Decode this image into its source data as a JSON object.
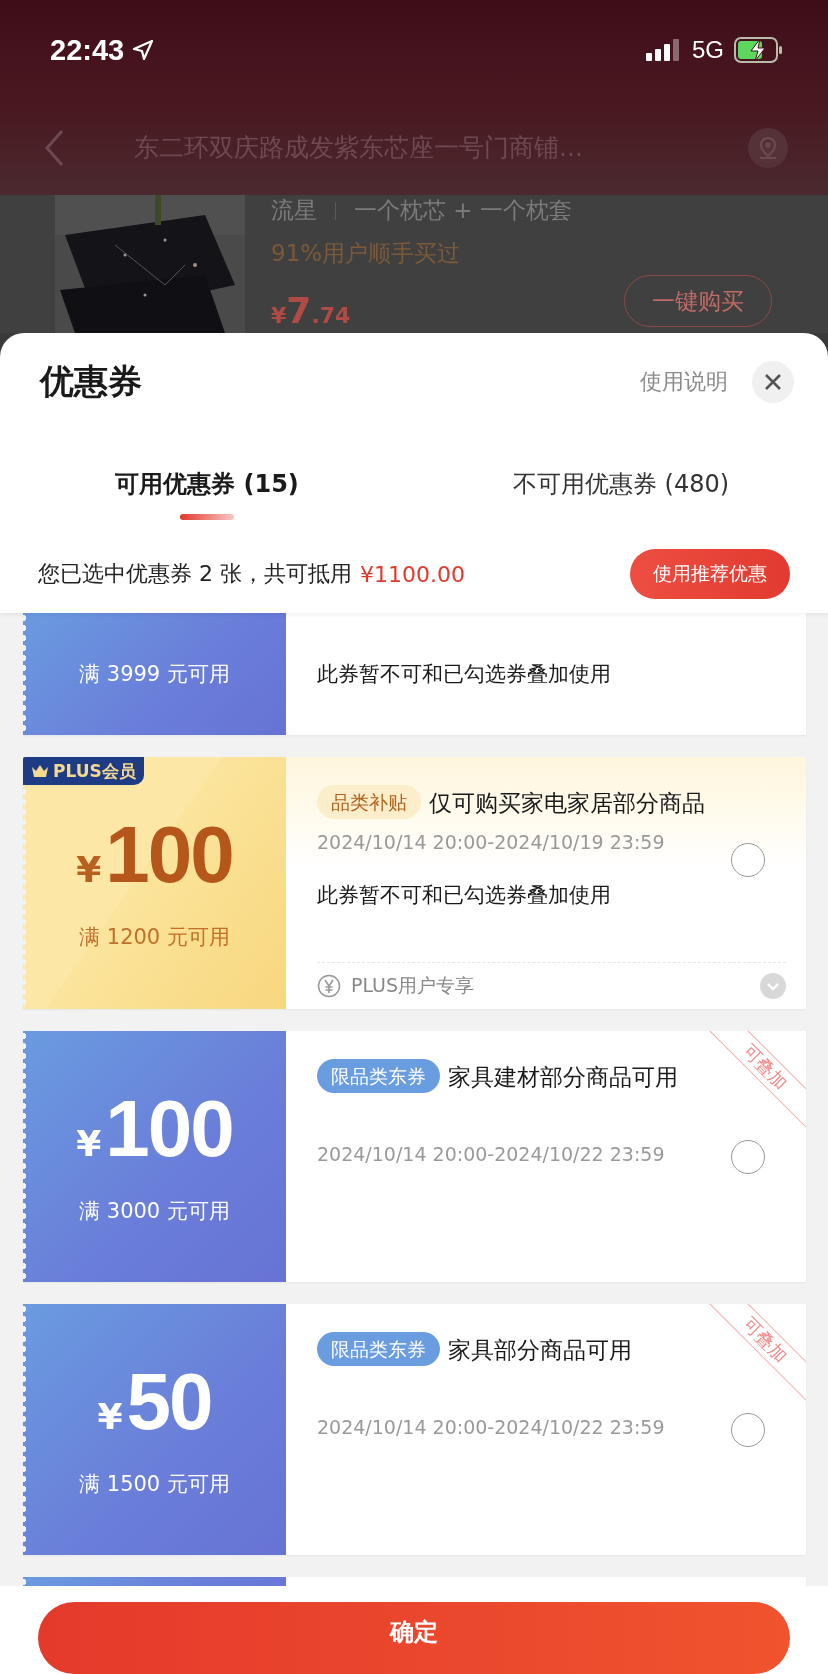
{
  "status_bar": {
    "time": "22:43",
    "network": "5G"
  },
  "nav": {
    "address": "东二环双庆路成发紫东芯座一号门商铺..."
  },
  "product": {
    "specs": [
      "流星",
      "一个枕芯 + 一个枕套"
    ],
    "social_proof": "91%用户顺手买过",
    "currency": "¥",
    "price_int": "7",
    "price_dec": ".74",
    "buy_button": "一键购买"
  },
  "sheet": {
    "title": "优惠券",
    "help": "使用说明"
  },
  "tabs": [
    {
      "label": "可用优惠券 (15)",
      "selected": true
    },
    {
      "label": "不可用优惠券 (480)",
      "selected": false
    }
  ],
  "summary": {
    "text": "您已选中优惠券 2 张，共可抵用",
    "amount": "¥1100.00",
    "button": "使用推荐优惠"
  },
  "coupons": [
    {
      "kind": "blue",
      "condition": "满 3999 元可用",
      "note": "此券暂不可和已勾选券叠加使用"
    },
    {
      "kind": "gold",
      "badge": "PLUS会员",
      "currency": "¥",
      "amount": "100",
      "condition": "满 1200 元可用",
      "tag": "品类补贴",
      "description": "仅可购买家电家居部分商品",
      "validity": "2024/10/14 20:00-2024/10/19 23:59",
      "note": "此券暂不可和已勾选券叠加使用",
      "footer": "PLUS用户专享",
      "selected": false
    },
    {
      "kind": "blue",
      "currency": "¥",
      "amount": "100",
      "condition": "满 3000 元可用",
      "tag": "限品类东券",
      "description": "家具建材部分商品可用",
      "validity": "2024/10/14 20:00-2024/10/22 23:59",
      "stamp": "可叠加",
      "selected": false
    },
    {
      "kind": "blue",
      "currency": "¥",
      "amount": "50",
      "condition": "满 1500 元可用",
      "tag": "限品类东券",
      "description": "家具部分商品可用",
      "validity": "2024/10/14 20:00-2024/10/22 23:59",
      "stamp": "可叠加",
      "selected": false
    },
    {
      "kind": "blue"
    }
  ],
  "confirm_button": "确定"
}
